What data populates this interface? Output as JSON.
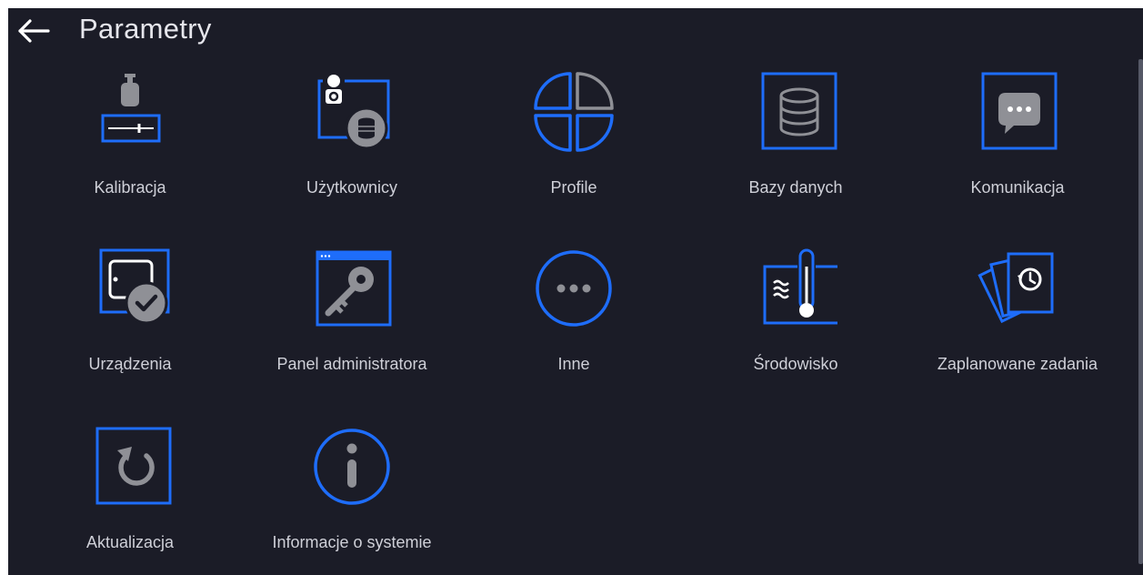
{
  "header": {
    "title": "Parametry",
    "back_icon": "arrow-left-icon"
  },
  "colors": {
    "background": "#1b1c27",
    "accent": "#1e6dfa",
    "icon_gray": "#8f9096",
    "text": "#cfd0d8"
  },
  "tiles": [
    {
      "label": "Kalibracja",
      "icon": "calibration-weight-icon"
    },
    {
      "label": "Użytkownicy",
      "icon": "users-database-icon"
    },
    {
      "label": "Profile",
      "icon": "profiles-pie-icon"
    },
    {
      "label": "Bazy danych",
      "icon": "database-icon"
    },
    {
      "label": "Komunikacja",
      "icon": "chat-bubble-icon"
    },
    {
      "label": "Urządzenia",
      "icon": "device-check-icon"
    },
    {
      "label": "Panel administratora",
      "icon": "admin-key-icon"
    },
    {
      "label": "Inne",
      "icon": "more-dots-icon"
    },
    {
      "label": "Środowisko",
      "icon": "thermometer-icon"
    },
    {
      "label": "Zaplanowane zadania",
      "icon": "scheduled-tasks-icon"
    },
    {
      "label": "Aktualizacja",
      "icon": "update-refresh-icon"
    },
    {
      "label": "Informacje o systemie",
      "icon": "info-icon"
    }
  ]
}
